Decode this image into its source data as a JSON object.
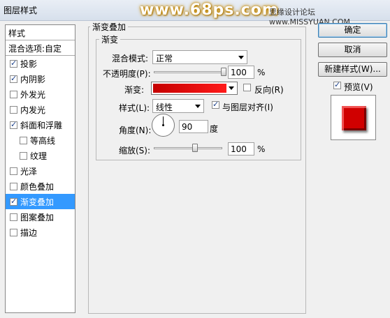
{
  "window": {
    "title": "图层样式",
    "watermark": "www.68ps.com",
    "watermark_right": "思缘设计论坛 www.MISSYUAN.COM"
  },
  "styles_panel": {
    "header": "样式",
    "blending_options": "混合选项:自定",
    "items": [
      {
        "label": "投影",
        "checked": true,
        "sub": false,
        "selected": false
      },
      {
        "label": "内阴影",
        "checked": true,
        "sub": false,
        "selected": false
      },
      {
        "label": "外发光",
        "checked": false,
        "sub": false,
        "selected": false
      },
      {
        "label": "内发光",
        "checked": false,
        "sub": false,
        "selected": false
      },
      {
        "label": "斜面和浮雕",
        "checked": true,
        "sub": false,
        "selected": false
      },
      {
        "label": "等高线",
        "checked": false,
        "sub": true,
        "selected": false
      },
      {
        "label": "纹理",
        "checked": false,
        "sub": true,
        "selected": false
      },
      {
        "label": "光泽",
        "checked": false,
        "sub": false,
        "selected": false
      },
      {
        "label": "颜色叠加",
        "checked": false,
        "sub": false,
        "selected": false
      },
      {
        "label": "渐变叠加",
        "checked": true,
        "sub": false,
        "selected": true
      },
      {
        "label": "图案叠加",
        "checked": false,
        "sub": false,
        "selected": false
      },
      {
        "label": "描边",
        "checked": false,
        "sub": false,
        "selected": false
      }
    ]
  },
  "gradient_overlay": {
    "group_title": "渐变叠加",
    "subgroup_title": "渐变",
    "blend_mode_label": "混合模式:",
    "blend_mode_value": "正常",
    "opacity_label": "不透明度(P):",
    "opacity_value": "100",
    "opacity_fraction": 1.0,
    "percent": "%",
    "gradient_label": "渐变:",
    "gradient_colors": [
      "#c50000",
      "#ff1a1a"
    ],
    "reverse_label": "反向(R)",
    "reverse_checked": false,
    "style_label": "样式(L):",
    "style_value": "线性",
    "align_label": "与图层对齐(I)",
    "align_checked": true,
    "angle_label": "角度(N):",
    "angle_value": "90",
    "angle_unit": "度",
    "scale_label": "缩放(S):",
    "scale_value": "100",
    "scale_fraction": 0.6
  },
  "buttons": {
    "ok": "确定",
    "cancel": "取消",
    "new_style": "新建样式(W)...",
    "preview_label": "预览(V)",
    "preview_checked": true
  },
  "colors": {
    "selection": "#3399ff",
    "preview_red": "#d00000"
  }
}
